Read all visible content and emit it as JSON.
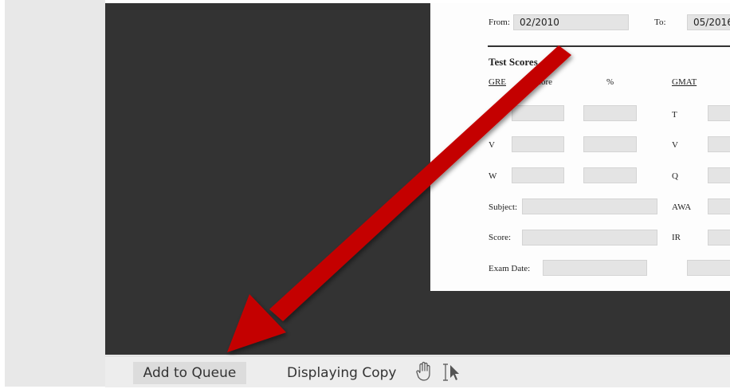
{
  "form": {
    "from_label": "From:",
    "from_value": "02/2010",
    "to_label": "To:",
    "to_value": "05/2016",
    "section_title": "Test Scores",
    "gre_header": "GRE",
    "score_header": "Score",
    "percent_header": "%",
    "gmat_header": "GMAT",
    "gre_rows": [
      "",
      "V",
      "W"
    ],
    "gmat_rows": [
      "T",
      "V",
      "Q"
    ],
    "subject_label": "Subject:",
    "awa_label": "AWA",
    "score_label": "Score:",
    "ir_label": "IR",
    "exam_date_label": "Exam Date:"
  },
  "toolbar": {
    "add_to_queue": "Add to Queue",
    "displaying_copy": "Displaying Copy",
    "hand_tool_icon": "hand-icon",
    "select_tool_icon": "text-select-cursor-icon"
  },
  "annotation": {
    "arrow_color": "#c40000",
    "arrow_icon": "red-arrow"
  }
}
